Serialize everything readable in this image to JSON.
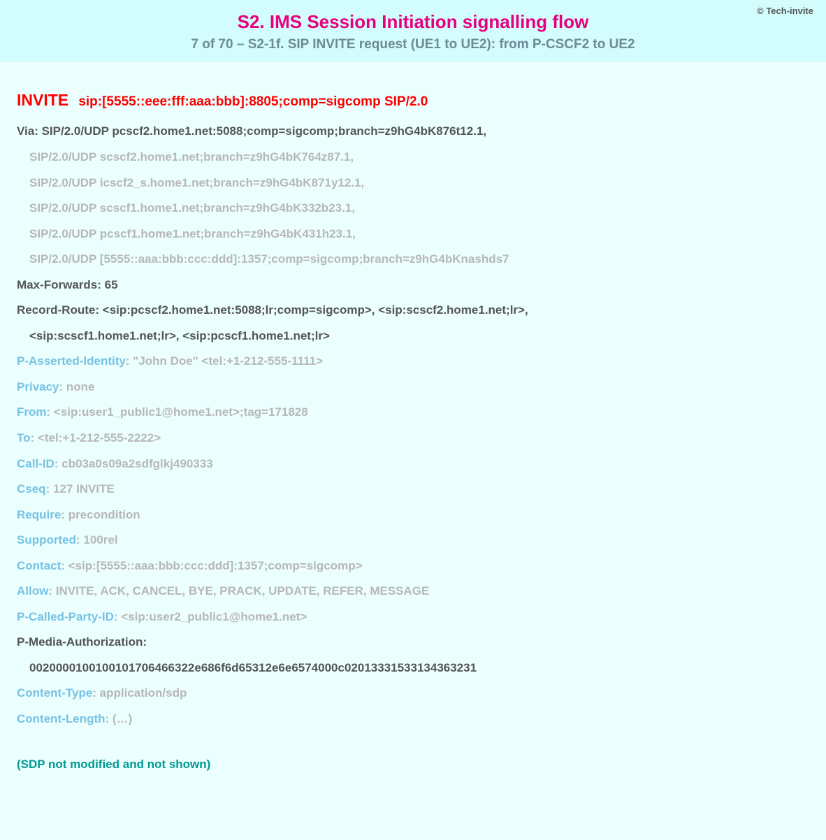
{
  "copyright": "© Tech-invite",
  "title": "S2. IMS Session Initiation signalling flow",
  "subtitle": "7 of 70 – S2-1f. SIP INVITE request (UE1 to UE2): from P-CSCF2 to UE2",
  "invite": {
    "method": "INVITE",
    "uri": "sip:[5555::eee:fff:aaa:bbb]:8805;comp=sigcomp SIP/2.0"
  },
  "via": {
    "first": "Via: SIP/2.0/UDP pcscf2.home1.net:5088;comp=sigcomp;branch=z9hG4bK876t12.1,",
    "more": [
      "SIP/2.0/UDP scscf2.home1.net;branch=z9hG4bK764z87.1,",
      "SIP/2.0/UDP icscf2_s.home1.net;branch=z9hG4bK871y12.1,",
      "SIP/2.0/UDP scscf1.home1.net;branch=z9hG4bK332b23.1,",
      "SIP/2.0/UDP pcscf1.home1.net;branch=z9hG4bK431h23.1,",
      "SIP/2.0/UDP [5555::aaa:bbb:ccc:ddd]:1357;comp=sigcomp;branch=z9hG4bKnashds7"
    ]
  },
  "maxForwards": "Max-Forwards: 65",
  "recordRoute": {
    "line1": "Record-Route: <sip:pcscf2.home1.net:5088;lr;comp=sigcomp>, <sip:scscf2.home1.net;lr>,",
    "line2": "<sip:scscf1.home1.net;lr>, <sip:pcscf1.home1.net;lr>"
  },
  "headers": {
    "pAssertedIdentity": {
      "k": "P-Asserted-Identity",
      "v": ": \"John Doe\" <tel:+1-212-555-1111>"
    },
    "privacy": {
      "k": "Privacy",
      "v": ": none"
    },
    "from": {
      "k": "From",
      "v": ": <sip:user1_public1@home1.net>;tag=171828"
    },
    "to": {
      "k": "To",
      "v": ": <tel:+1-212-555-2222>"
    },
    "callId": {
      "k": "Call-ID",
      "v": ": cb03a0s09a2sdfglkj490333"
    },
    "cseq": {
      "k": "Cseq",
      "v": ": 127 INVITE"
    },
    "require": {
      "k": "Require",
      "v": ": precondition"
    },
    "supported": {
      "k": "Supported",
      "v": ": 100rel"
    },
    "contact": {
      "k": "Contact",
      "v": ": <sip:[5555::aaa:bbb:ccc:ddd]:1357;comp=sigcomp>"
    },
    "allow": {
      "k": "Allow",
      "v": ": INVITE, ACK, CANCEL, BYE, PRACK, UPDATE, REFER, MESSAGE"
    },
    "pCalledPartyId": {
      "k": "P-Called-Party-ID",
      "v": ": <sip:user2_public1@home1.net>"
    },
    "contentType": {
      "k": "Content-Type",
      "v": ": application/sdp"
    },
    "contentLength": {
      "k": "Content-Length",
      "v": ": (…)"
    }
  },
  "pMediaAuth": {
    "k": "P-Media-Authorization:",
    "v": "0020000100100101706466322e686f6d65312e6e6574000c02013331533134363231"
  },
  "sdpNote": "(SDP not modified and not shown)"
}
